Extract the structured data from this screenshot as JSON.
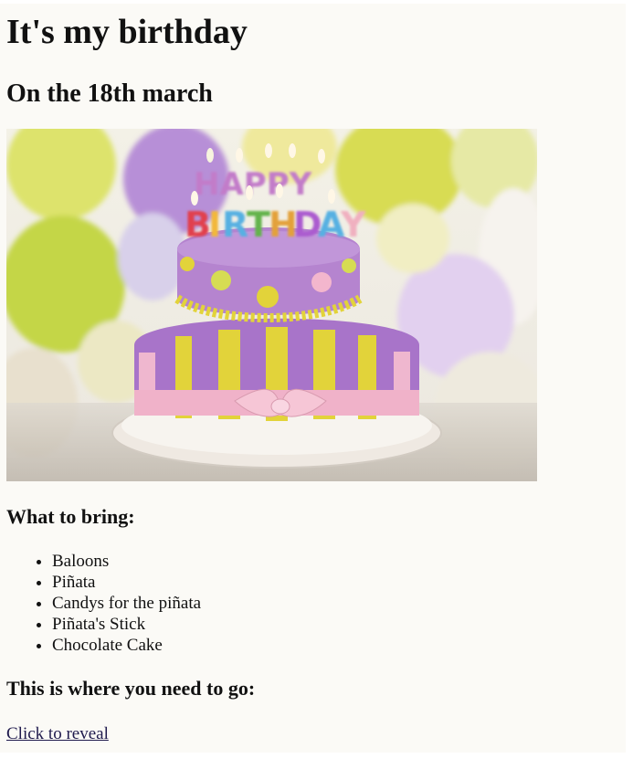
{
  "page": {
    "title": "It's my birthday",
    "subtitle": "On the 18th march",
    "bring_heading": "What to bring:",
    "bring_items": [
      "Baloons",
      "Piñata",
      "Candys for the piñata",
      "Piñata's Stick",
      "Chocolate Cake"
    ],
    "location_heading": "This is where you need to go:",
    "reveal_link": "Click to reveal"
  },
  "image": {
    "cake_text": "HAPPY BIRTHDAY",
    "colors": {
      "purple": "#a071c6",
      "yellow": "#e2d33a",
      "pink": "#f0b2c9",
      "plate": "#f3eee6",
      "table": "#c9c1b6"
    }
  }
}
